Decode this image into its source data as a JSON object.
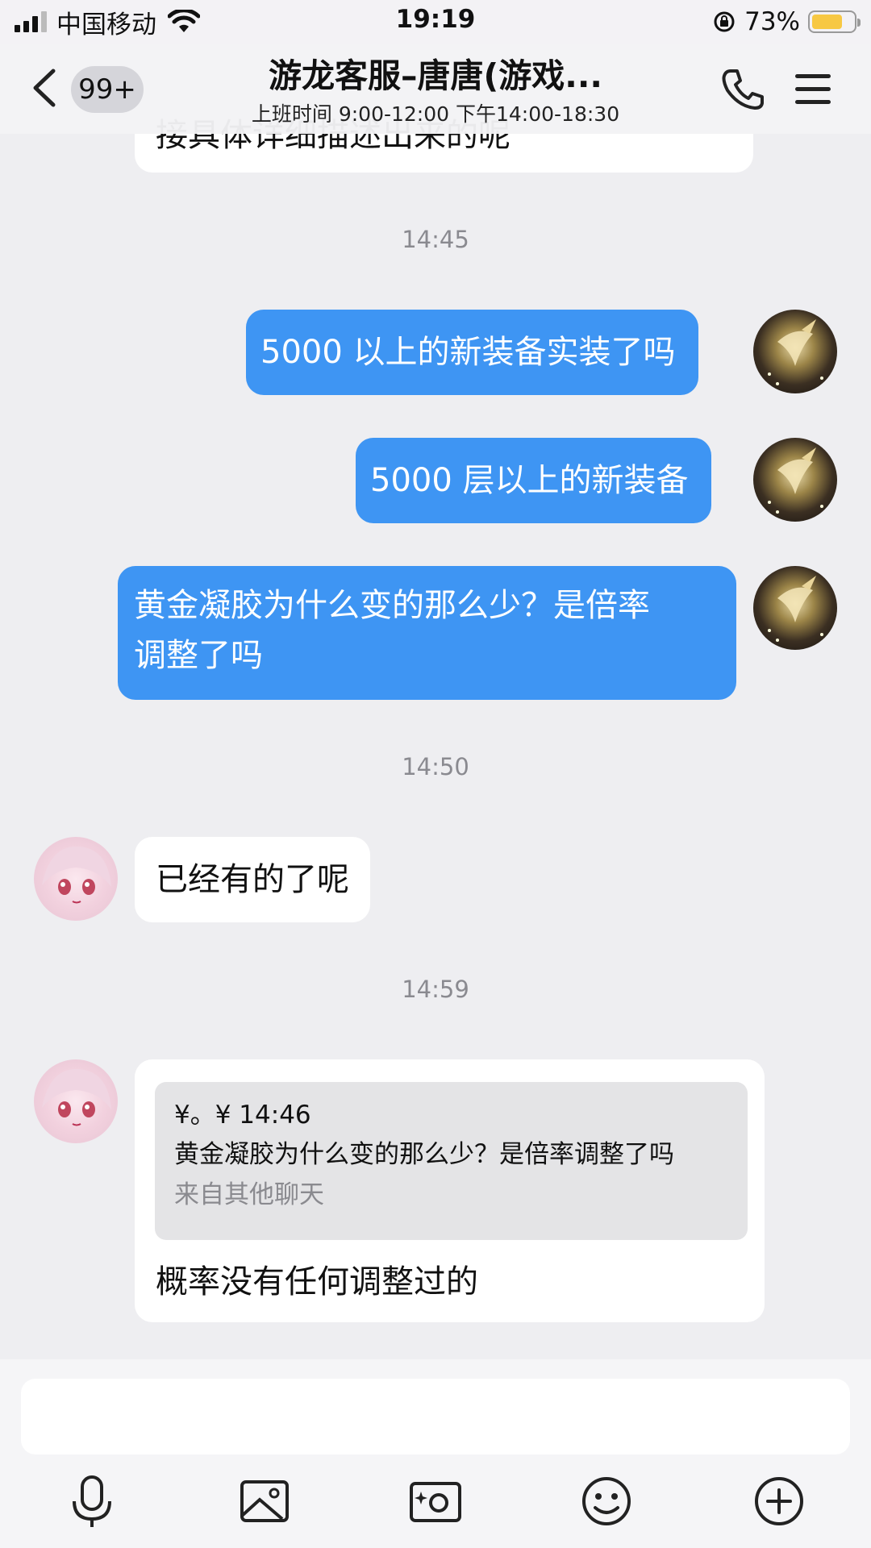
{
  "status_bar": {
    "carrier": "中国移动",
    "time": "19:19",
    "battery_percent": "73%",
    "battery_level": 0.73,
    "battery_color": "#f7c843"
  },
  "header": {
    "back_icon": "chevron-left-icon",
    "unread_badge": "99+",
    "title": "游龙客服–唐唐(游戏...",
    "subtitle": "上班时间 9:00-12:00 下午14:00-18:30",
    "phone_icon": "phone-icon",
    "menu_icon": "hamburger-menu-icon"
  },
  "chat": {
    "partial_top_message": "接具体详细描述出来的呢",
    "timestamps": [
      "14:45",
      "14:50",
      "14:59"
    ],
    "messages": [
      {
        "sender": "me",
        "text": "5000 以上的新装备实装了吗"
      },
      {
        "sender": "me",
        "text": "5000 层以上的新装备"
      },
      {
        "sender": "me",
        "text_line1": "黄金凝胶为什么变的那么少？是倍率",
        "text_line2": "调整了吗"
      },
      {
        "sender": "agent",
        "text": "已经有的了呢"
      },
      {
        "sender": "agent",
        "quote": {
          "header": "¥。¥ 14:46",
          "text": "黄金凝胶为什么变的那么少？是倍率调整了吗",
          "source": "来自其他聊天"
        },
        "text": "概率没有任何调整过的"
      }
    ]
  },
  "input_bar": {
    "placeholder": "",
    "tools": [
      "microphone-icon",
      "image-icon",
      "camera-icon",
      "emoji-icon",
      "plus-icon"
    ]
  },
  "colors": {
    "my_bubble": "#3e95f3",
    "their_bubble": "#ffffff",
    "background": "#eeeef1"
  }
}
